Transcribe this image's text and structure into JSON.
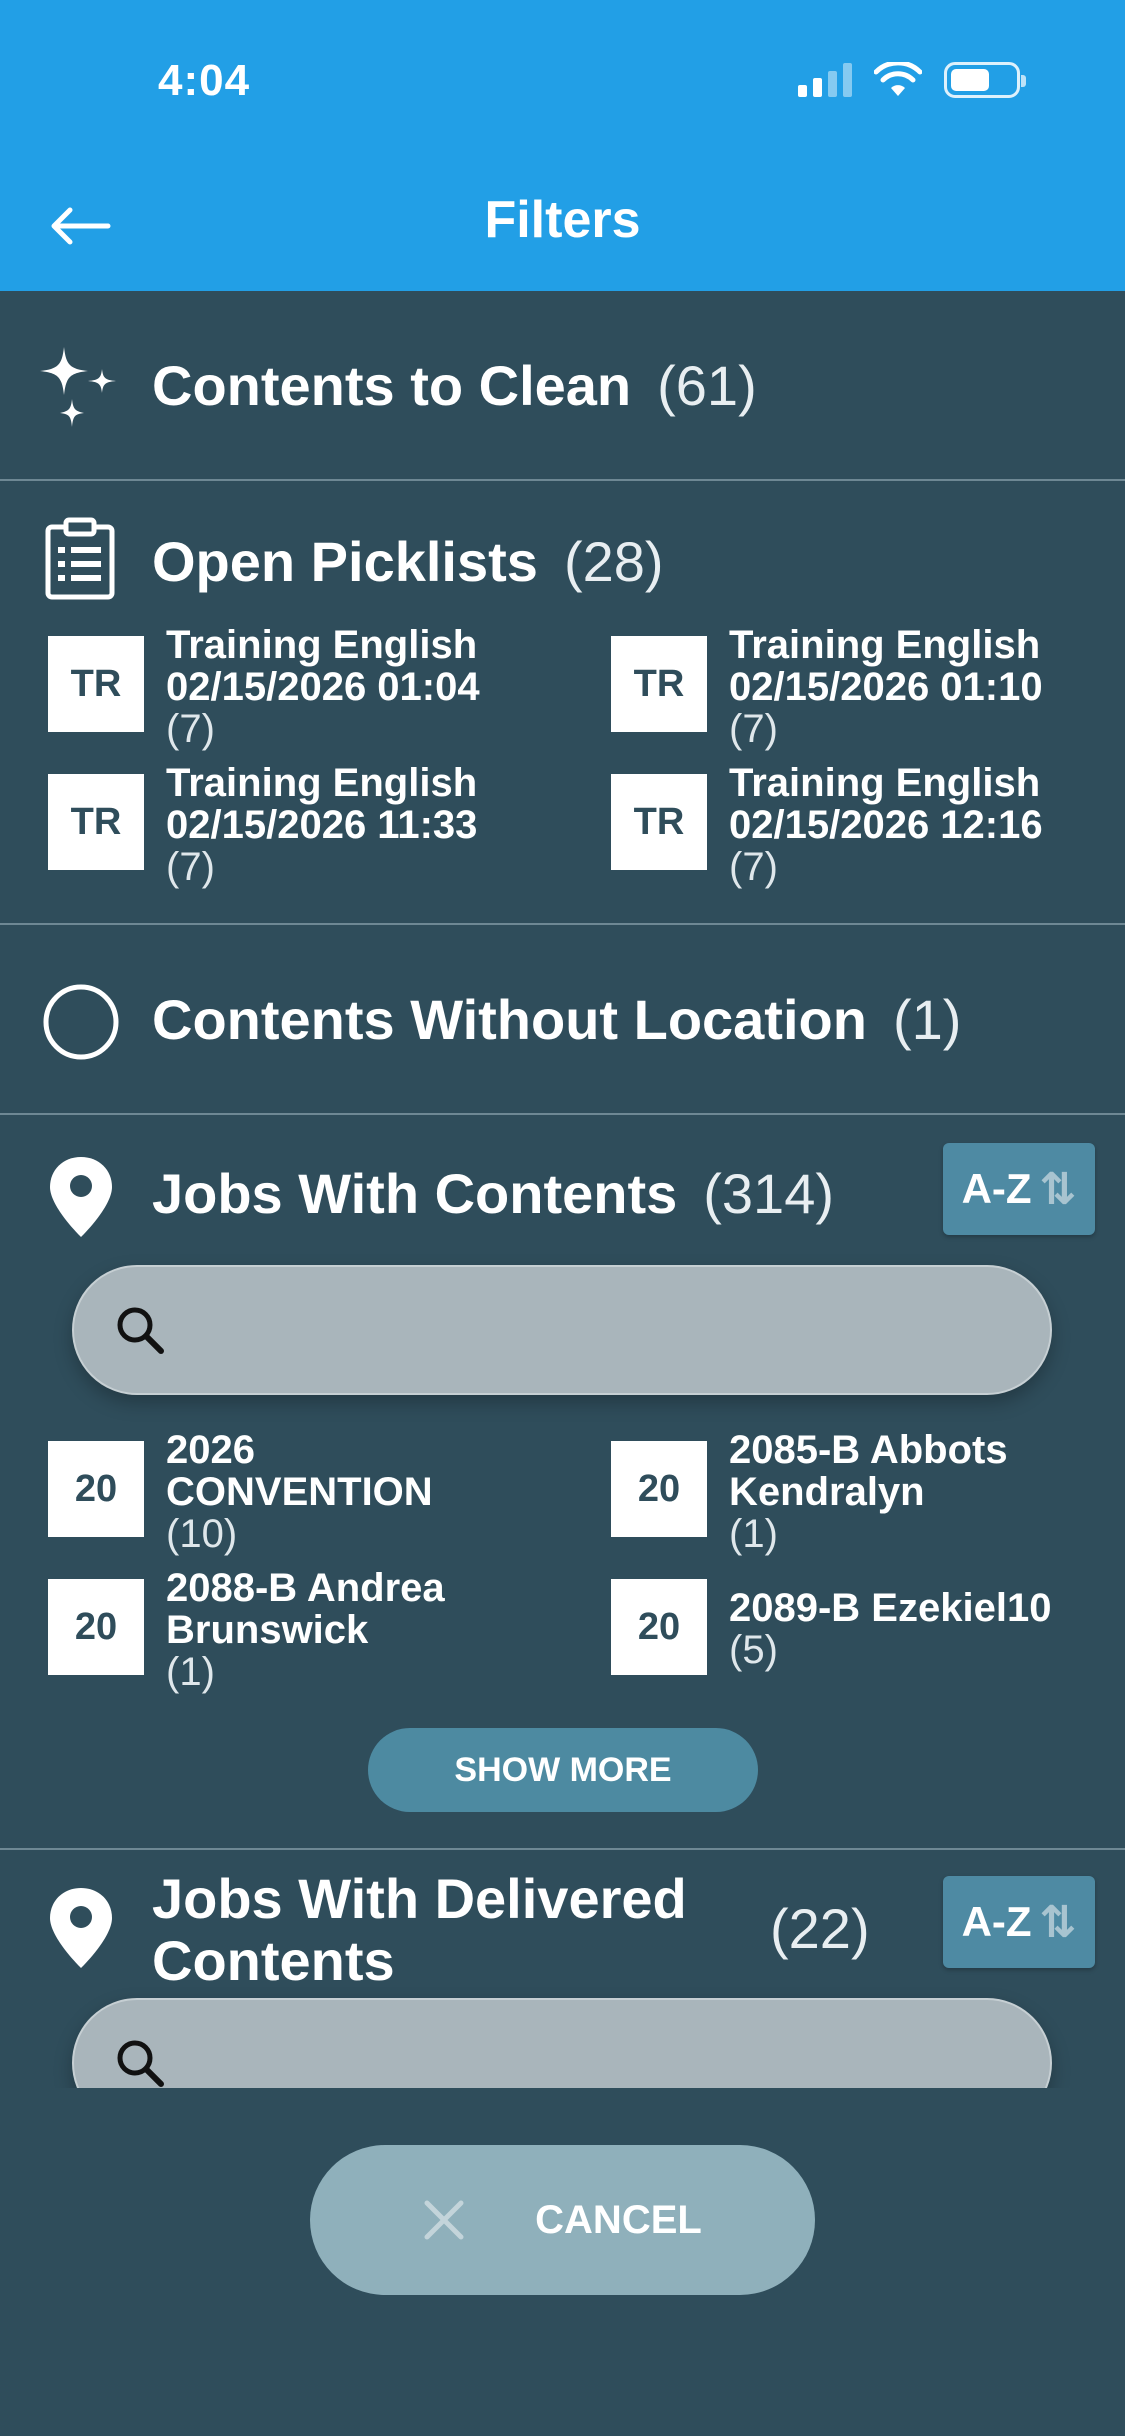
{
  "status": {
    "time": "4:04"
  },
  "header": {
    "title": "Filters"
  },
  "sections": {
    "clean": {
      "title": "Contents to Clean",
      "count": "(61)"
    },
    "picklists": {
      "title": "Open Picklists",
      "count": "(28)",
      "items": [
        {
          "badge": "TR",
          "line1": "Training English",
          "line2": "02/15/2026 01:04",
          "count": "(7)"
        },
        {
          "badge": "TR",
          "line1": "Training English",
          "line2": "02/15/2026 01:10",
          "count": "(7)"
        },
        {
          "badge": "TR",
          "line1": "Training English",
          "line2": "02/15/2026 11:33",
          "count": "(7)"
        },
        {
          "badge": "TR",
          "line1": "Training English",
          "line2": "02/15/2026 12:16",
          "count": "(7)"
        }
      ]
    },
    "without_location": {
      "title": "Contents Without Location",
      "count": "(1)"
    },
    "jobs": {
      "title": "Jobs With Contents",
      "count": "(314)",
      "sort_label": "A-Z",
      "search_placeholder": "",
      "items": [
        {
          "badge": "20",
          "line1": "2026",
          "line2": "CONVENTION",
          "count": "(10)"
        },
        {
          "badge": "20",
          "line1": "2085-B Abbots",
          "line2": "Kendralyn",
          "count": "(1)"
        },
        {
          "badge": "20",
          "line1": "2088-B Andrea",
          "line2": "Brunswick",
          "count": "(1)"
        },
        {
          "badge": "20",
          "line1": "2089-B Ezekiel10",
          "line2": "",
          "count": "(5)"
        }
      ],
      "show_more_label": "SHOW MORE"
    },
    "delivered": {
      "title_line1": "Jobs With Delivered",
      "title_line2": "Contents",
      "count": "(22)",
      "sort_label": "A-Z",
      "search_placeholder": ""
    }
  },
  "footer": {
    "cancel_label": "CANCEL"
  },
  "colors": {
    "header": "#229fe6",
    "background": "#2f4d5b",
    "accent": "#4d8aa1"
  },
  "icons": [
    "back-arrow-icon",
    "sparkles-icon",
    "clipboard-icon",
    "circle-icon",
    "location-pin-icon",
    "search-icon",
    "sort-arrows-icon",
    "close-icon",
    "wifi-icon",
    "battery-icon",
    "signal-icon"
  ]
}
